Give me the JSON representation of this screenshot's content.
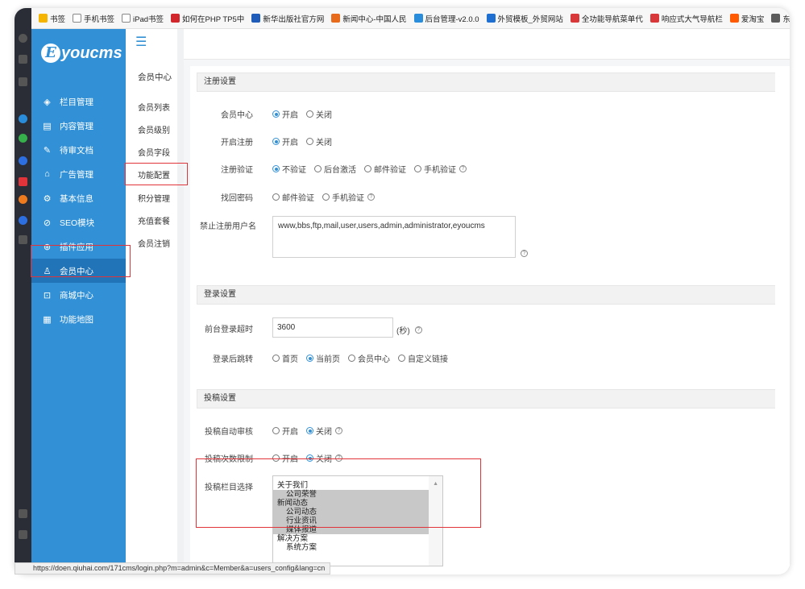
{
  "bookmarks": [
    {
      "label": "书签",
      "color": "#f5b400"
    },
    {
      "label": "手机书签",
      "color": "#ffffff"
    },
    {
      "label": "iPad书签",
      "color": "#ffffff"
    },
    {
      "label": "如何在PHP TP5中",
      "color": "#d0262c"
    },
    {
      "label": "新华出版社官方网",
      "color": "#1f5bb8"
    },
    {
      "label": "新闻中心-中国人民",
      "color": "#e86a1b"
    },
    {
      "label": "后台管理-v2.0.0",
      "color": "#2a8ddc"
    },
    {
      "label": "外贸模板_外贸网站",
      "color": "#1e6fd1"
    },
    {
      "label": "全功能导航菜单代",
      "color": "#d8383a"
    },
    {
      "label": "响应式大气导航栏",
      "color": "#d8383a"
    },
    {
      "label": "爱淘宝",
      "color": "#ff5a00"
    },
    {
      "label": "东",
      "color": "#5c5c5c"
    }
  ],
  "logo": {
    "letter": "E",
    "text": "youcms"
  },
  "nav": [
    {
      "label": "栏目管理",
      "icon": "◈",
      "name": "nav-column"
    },
    {
      "label": "内容管理",
      "icon": "▤",
      "name": "nav-content"
    },
    {
      "label": "待审文档",
      "icon": "✎",
      "name": "nav-pending"
    },
    {
      "label": "广告管理",
      "icon": "⌂",
      "name": "nav-ads"
    },
    {
      "label": "基本信息",
      "icon": "⚙",
      "name": "nav-info"
    },
    {
      "label": "SEO模块",
      "icon": "⊘",
      "name": "nav-seo"
    },
    {
      "label": "插件应用",
      "icon": "⊛",
      "name": "nav-plugins"
    },
    {
      "label": "会员中心",
      "icon": "♙",
      "name": "nav-members"
    },
    {
      "label": "商城中心",
      "icon": "⊡",
      "name": "nav-shop"
    },
    {
      "label": "功能地图",
      "icon": "▦",
      "name": "nav-map"
    }
  ],
  "subnav": {
    "title": "会员中心",
    "items": [
      "会员列表",
      "会员级别",
      "会员字段",
      "功能配置",
      "积分管理",
      "充值套餐",
      "会员注销"
    ]
  },
  "sections": {
    "register": "注册设置",
    "login": "登录设置",
    "submit": "投稿设置"
  },
  "form": {
    "member_center": {
      "label": "会员中心",
      "options": [
        "开启",
        "关闭"
      ],
      "selected": 0
    },
    "open_register": {
      "label": "开启注册",
      "options": [
        "开启",
        "关闭"
      ],
      "selected": 0
    },
    "register_verify": {
      "label": "注册验证",
      "options": [
        "不验证",
        "后台激活",
        "邮件验证",
        "手机验证"
      ],
      "selected": 0
    },
    "find_password": {
      "label": "找回密码",
      "options": [
        "邮件验证",
        "手机验证"
      ],
      "selected": -1
    },
    "banned_names": {
      "label": "禁止注册用户名",
      "value": "www,bbs,ftp,mail,user,users,admin,administrator,eyoucms"
    },
    "login_timeout": {
      "label": "前台登录超时",
      "value": "3600",
      "unit": "(秒)"
    },
    "login_redirect": {
      "label": "登录后跳转",
      "options": [
        "首页",
        "当前页",
        "会员中心",
        "自定义链接"
      ],
      "selected": 1
    },
    "auto_review": {
      "label": "投稿自动审核",
      "options": [
        "开启",
        "关闭"
      ],
      "selected": 1
    },
    "submit_limit": {
      "label": "投稿次数限制",
      "options": [
        "开启",
        "关闭"
      ],
      "selected": 1
    },
    "submit_columns": {
      "label": "投稿栏目选择",
      "items": [
        {
          "label": "关于我们",
          "child": false,
          "selected": false
        },
        {
          "label": "公司荣誉",
          "child": true,
          "selected": true
        },
        {
          "label": "新闻动态",
          "child": false,
          "selected": true
        },
        {
          "label": "公司动态",
          "child": true,
          "selected": true
        },
        {
          "label": "行业资讯",
          "child": true,
          "selected": true
        },
        {
          "label": "媒体报道",
          "child": true,
          "selected": true
        },
        {
          "label": "解决方案",
          "child": false,
          "selected": false
        },
        {
          "label": "系统方案",
          "child": true,
          "selected": false
        }
      ]
    }
  },
  "help_symbol": "?",
  "status_url": "https://doen.qiuhai.com/171cms/login.php?m=admin&c=Member&a=users_config&lang=cn",
  "colors": {
    "sidebar": "#3291d6",
    "active": "#2274b8",
    "highlight": "#e0333a"
  }
}
